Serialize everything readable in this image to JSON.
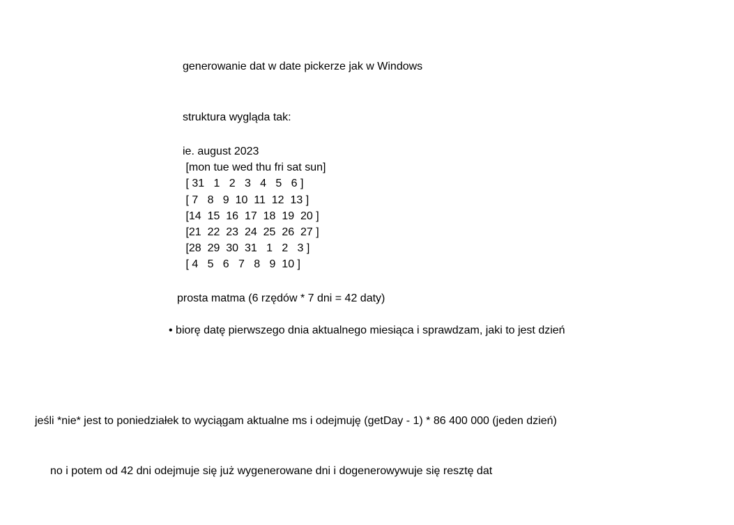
{
  "title": "generowanie dat w date pickerze jak w Windows",
  "structureLabel": "struktura wygląda tak:",
  "calendar": {
    "header": "ie. august 2023",
    "weekdays": " [mon tue wed thu fri sat sun]",
    "rows": [
      " [ 31   1   2   3   4   5   6 ]",
      " [ 7   8   9  10  11  12  13 ]",
      " [14  15  16  17  18  19  20 ]",
      " [21  22  23  24  25  26  27 ]",
      " [28  29  30  31   1   2   3 ]",
      " [ 4   5   6   7   8   9  10 ]"
    ]
  },
  "mathNote": "prosta matma (6 rzędów * 7 dni = 42 daty)",
  "bullet": "• biorę datę pierwszego dnia aktualnego miesiąca i sprawdzam, jaki to jest dzień",
  "line1": "jeśli *nie* jest to poniedziałek to wyciągam aktualne ms i odejmuję (getDay - 1) * 86 400 000 (jeden dzień)",
  "line2": "no i potem od 42 dni odejmuje się już wygenerowane dni i dogenerowywuje się resztę dat"
}
